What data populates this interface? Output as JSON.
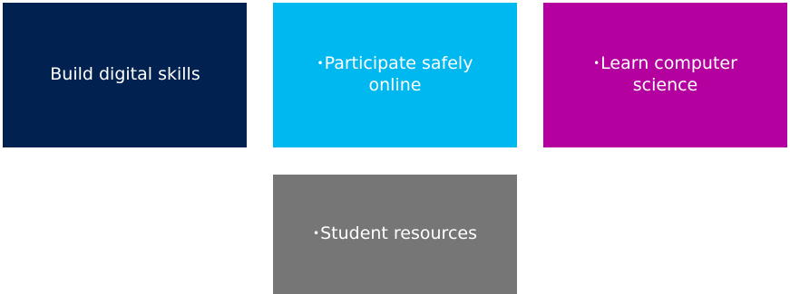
{
  "tiles": [
    {
      "label": "Build digital skills",
      "bullet": "",
      "color": "#012250"
    },
    {
      "label": "Participate safely online",
      "bullet": "•",
      "color": "#00b8f0"
    },
    {
      "label": "Learn computer science",
      "bullet": "•",
      "color": "#b4009e"
    },
    {
      "label": "Student resources",
      "bullet": "•",
      "color": "#767676"
    }
  ]
}
